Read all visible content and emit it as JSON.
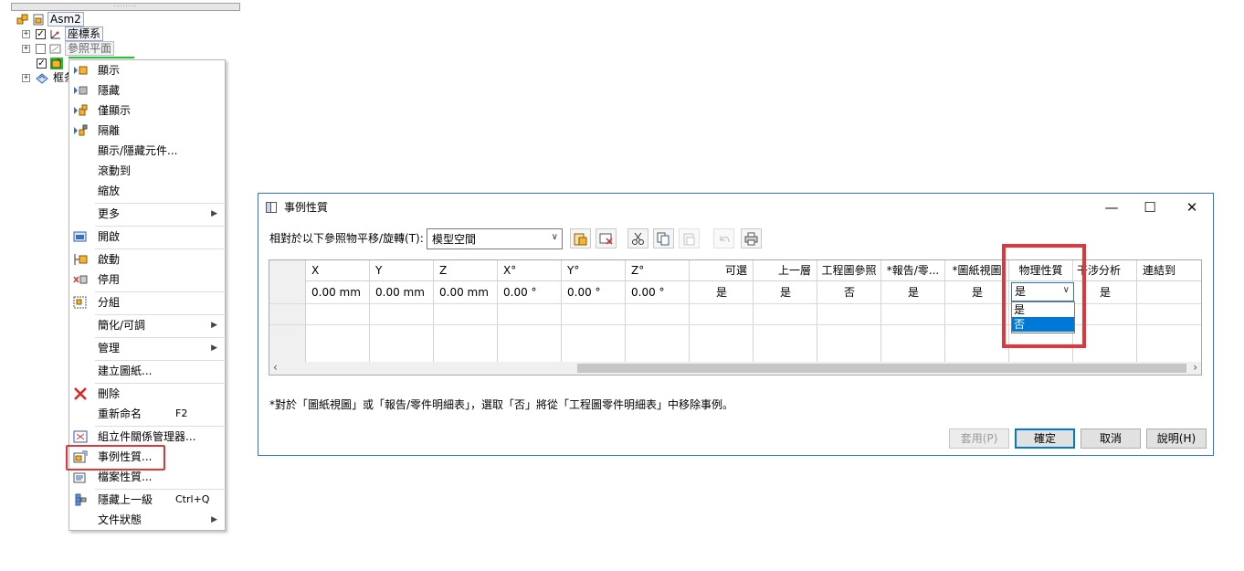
{
  "tree": {
    "root_label": "Asm2",
    "nodes": [
      {
        "label": "座標系"
      },
      {
        "label": "參照平面"
      },
      {
        "label": ""
      },
      {
        "label": "框条"
      }
    ]
  },
  "context_menu": {
    "items": [
      {
        "label": "顯示",
        "shortcut": "",
        "icon": "show-icon"
      },
      {
        "label": "隱藏",
        "shortcut": "",
        "icon": "hide-icon"
      },
      {
        "label": "僅顯示",
        "shortcut": "",
        "icon": "show-only-icon"
      },
      {
        "label": "隔離",
        "shortcut": "",
        "icon": "isolate-icon"
      },
      {
        "label": "顯示/隱藏元件...",
        "shortcut": "",
        "icon": ""
      },
      {
        "label": "滾動到",
        "shortcut": "",
        "icon": ""
      },
      {
        "label": "縮放",
        "shortcut": "",
        "icon": ""
      },
      {
        "label": "更多",
        "shortcut": "",
        "icon": ""
      },
      {
        "label": "開啟",
        "shortcut": "",
        "icon": "open-icon"
      },
      {
        "label": "啟動",
        "shortcut": "",
        "icon": "activate-icon"
      },
      {
        "label": "停用",
        "shortcut": "",
        "icon": "deactivate-icon"
      },
      {
        "label": "分組",
        "shortcut": "",
        "icon": "group-icon"
      },
      {
        "label": "簡化/可調",
        "shortcut": "",
        "icon": ""
      },
      {
        "label": "管理",
        "shortcut": "",
        "icon": ""
      },
      {
        "label": "建立圖紙...",
        "shortcut": "",
        "icon": ""
      },
      {
        "label": "刪除",
        "shortcut": "",
        "icon": "delete-icon"
      },
      {
        "label": "重新命名",
        "shortcut": "F2",
        "icon": ""
      },
      {
        "label": "組立件關係管理器...",
        "shortcut": "",
        "icon": "relationship-manager-icon"
      },
      {
        "label": "事例性質...",
        "shortcut": "",
        "icon": "occurrence-properties-icon"
      },
      {
        "label": "檔案性質...",
        "shortcut": "",
        "icon": "file-properties-icon"
      },
      {
        "label": "隱藏上一級",
        "shortcut": "Ctrl+Q",
        "icon": "hide-previous-level-icon"
      },
      {
        "label": "文件狀態",
        "shortcut": "",
        "icon": ""
      }
    ]
  },
  "dialog": {
    "title": "事例性質",
    "window_controls": {
      "minimize": "—",
      "maximize": "☐",
      "close": "✕"
    },
    "reference_label": "相對於以下參照物平移/旋轉(T):",
    "reference_value": "模型空間",
    "columns": [
      "X",
      "Y",
      "Z",
      "X°",
      "Y°",
      "Z°",
      "可選",
      "上一層",
      "工程圖參照",
      "*報告/零...",
      "*圖紙視圖",
      "物理性質",
      "干涉分析",
      "連結到"
    ],
    "rows": [
      [
        "0.00 mm",
        "0.00 mm",
        "0.00 mm",
        "0.00 °",
        "0.00 °",
        "0.00 °",
        "是",
        "是",
        "否",
        "是",
        "是",
        "是",
        "是",
        ""
      ]
    ],
    "dropdown_options": [
      "是",
      "否"
    ],
    "dropdown_selected_index": 1,
    "note": "*對於「圖紙視圖」或「報告/零件明細表」，選取「否」將從「工程圖零件明細表」中移除事例。",
    "buttons": {
      "apply": "套用(P)",
      "ok": "確定",
      "cancel": "取消",
      "help": "說明(H)"
    }
  },
  "colors": {
    "highlight": "#e2363c",
    "accent": "#0078d7",
    "tree_active": "#22c22e"
  }
}
